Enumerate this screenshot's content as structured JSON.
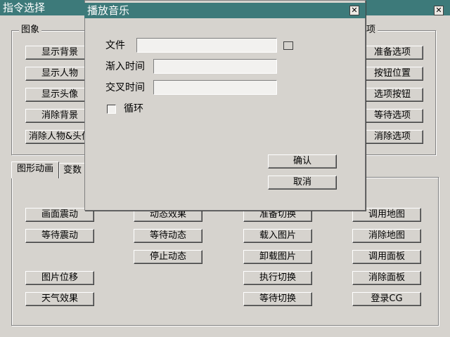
{
  "main_window": {
    "title": "指令选择",
    "close_glyph": "✕",
    "image_group": {
      "label": "图象",
      "buttons": [
        "显示背景",
        "显示人物",
        "显示头像",
        "消除背景",
        "消除人物&头像"
      ]
    },
    "options_group": {
      "label": "项",
      "buttons": [
        "准备选项",
        "按钮位置",
        "选项按钮",
        "等待选项",
        "消除选项"
      ]
    },
    "tabs": [
      "图形动画",
      "变数"
    ],
    "tab_panel": {
      "col1": [
        "画面震动",
        "等待震动",
        "图片位移",
        "天气效果"
      ],
      "col2": [
        "动态效果",
        "等待动态",
        "停止动态"
      ],
      "col3": [
        "准备切换",
        "载入图片",
        "卸载图片",
        "执行切换",
        "等待切换"
      ],
      "col4": [
        "调用地图",
        "消除地图",
        "调用面板",
        "消除面板",
        "登录CG"
      ]
    }
  },
  "dialog": {
    "title": "播放音乐",
    "close_glyph": "✕",
    "file_label": "文件",
    "file_value": "",
    "fade_in_label": "渐入时间",
    "fade_in_value": "",
    "crossfade_label": "交叉时间",
    "crossfade_value": "",
    "loop_label": "循环",
    "loop_checked": false,
    "ok_label": "确认",
    "cancel_label": "取消"
  }
}
